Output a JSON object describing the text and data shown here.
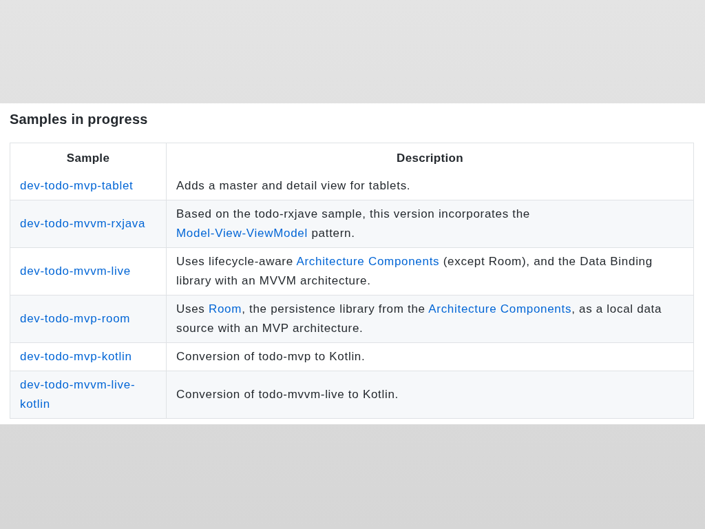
{
  "heading": "Samples in progress",
  "table": {
    "columns": [
      "Sample",
      "Description"
    ],
    "rows": [
      {
        "sample": "dev-todo-mvp-tablet",
        "description": [
          {
            "text": "Adds a master and detail view for tablets.",
            "link": false
          }
        ]
      },
      {
        "sample": "dev-todo-mvvm-rxjava",
        "description": [
          {
            "text": "Based on the todo-rxjave sample, this version incorporates the ",
            "link": false
          },
          {
            "text": "Model-View-ViewModel",
            "link": true
          },
          {
            "text": " pattern.",
            "link": false
          }
        ]
      },
      {
        "sample": "dev-todo-mvvm-live",
        "description": [
          {
            "text": "Uses lifecycle-aware ",
            "link": false
          },
          {
            "text": "Architecture Components",
            "link": true
          },
          {
            "text": " (except Room), and the Data Binding library with an MVVM architecture.",
            "link": false
          }
        ]
      },
      {
        "sample": "dev-todo-mvp-room",
        "description": [
          {
            "text": "Uses ",
            "link": false
          },
          {
            "text": "Room",
            "link": true
          },
          {
            "text": ", the persistence library from the ",
            "link": false
          },
          {
            "text": "Architecture Components",
            "link": true
          },
          {
            "text": ", as a local data source with an MVP architecture.",
            "link": false
          }
        ]
      },
      {
        "sample": "dev-todo-mvp-kotlin",
        "description": [
          {
            "text": "Conversion of todo-mvp to Kotlin.",
            "link": false
          }
        ]
      },
      {
        "sample": "dev-todo-mvvm-live-kotlin",
        "description": [
          {
            "text": "Conversion of todo-mvvm-live to Kotlin.",
            "link": false
          }
        ]
      }
    ]
  }
}
